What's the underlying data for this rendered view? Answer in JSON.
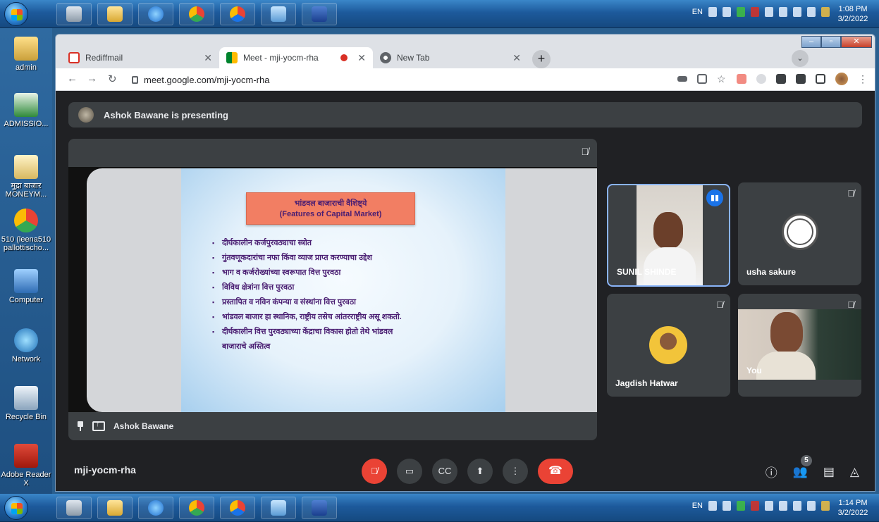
{
  "taskbar_top": {
    "lang": "EN",
    "time": "1:08 PM",
    "date": "3/2/2022"
  },
  "taskbar_bottom": {
    "lang": "EN",
    "time": "1:14 PM",
    "date": "3/2/2022"
  },
  "desktop": {
    "icons": [
      {
        "label": "admin",
        "icon": "user-folder-icon"
      },
      {
        "label": "ADMISSIO...",
        "icon": "excel-file-icon"
      },
      {
        "label": "मुद्रा बाजार MONEYM...",
        "icon": "document-icon"
      },
      {
        "label": "510 (leena510 pallottischo...",
        "icon": "chrome-user-icon"
      },
      {
        "label": "Computer",
        "icon": "computer-icon"
      },
      {
        "label": "Network",
        "icon": "network-icon"
      },
      {
        "label": "Recycle Bin",
        "icon": "recycle-bin-icon"
      },
      {
        "label": "Adobe Reader X",
        "icon": "adobe-reader-icon"
      }
    ]
  },
  "browser": {
    "tabs": [
      {
        "title": "Rediffmail",
        "favicon": "rediffmail-icon"
      },
      {
        "title": "Meet - mji-yocm-rha",
        "favicon": "meet-icon"
      },
      {
        "title": "New Tab",
        "favicon": "chrome-icon"
      }
    ],
    "url": "meet.google.com/mji-yocm-rha"
  },
  "meet": {
    "presenting_banner": "Ashok Bawane is presenting",
    "presenter_name": "Ashok Bawane",
    "slide": {
      "title_line1": "भांडवल बाजाराची वैशिष्ट्ये",
      "title_line2": "(Features of Capital Market)",
      "bullets": [
        "दीर्घकालीन कर्जपुरवठ्याचा स्त्रोत",
        "गुंतवणूकदारांचा नफा किंवा व्याज प्राप्त करण्याचा उद्देश",
        "भाग व कर्जरोख्यांच्या स्वरूपात वित्त पुरवठा",
        "विविध क्षेत्रांना वित्त पुरवठा",
        "प्रस्तापित व नविन कंपन्या व संस्थांना वित्त पुरवठा",
        "भांडवल बाजार हा स्थानिक, राष्ट्रीय तसेच आंतरराष्ट्रीय असू शकतो.",
        "दीर्घकालीन वित्त पुरवठ्याच्या केंद्राचा विकास होतो तेथे भांडवल",
        "बाजाराचे अस्तित्व"
      ]
    },
    "participants": [
      {
        "name": "SUNIL SHINDE"
      },
      {
        "name": "usha sakure"
      },
      {
        "name": "Jagdish Hatwar"
      },
      {
        "name": "You"
      }
    ],
    "meeting_code": "mji-yocm-rha",
    "people_count": "5"
  },
  "colors": {
    "meet_bg": "#202124",
    "tile_bg": "#3c4043",
    "end_call": "#ea4335",
    "speaking_border": "#8ab4f8",
    "slide_title_bg": "#f27e63",
    "slide_text": "#4a1e72"
  }
}
